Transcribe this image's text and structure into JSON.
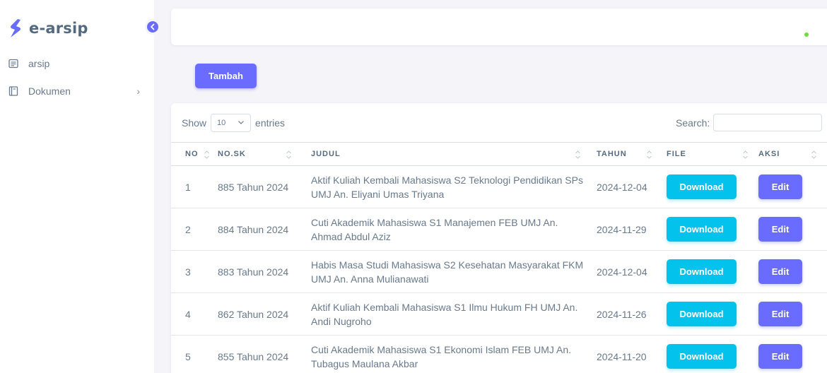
{
  "brand": {
    "name": "e-arsip",
    "logo_icon": "bolt-logo-icon",
    "accent": "#696cff"
  },
  "sidebar": {
    "collapse_icon": "chevron-left-icon",
    "items": [
      {
        "label": "arsip",
        "icon": "list-icon"
      },
      {
        "label": "Dokumen",
        "icon": "book-icon",
        "has_submenu": true
      }
    ]
  },
  "navbar": {
    "status_color": "#71dd37"
  },
  "actions": {
    "add_label": "Tambah"
  },
  "table": {
    "show_label": "Show",
    "entries_value": "10",
    "entries_label": "entries",
    "search_label": "Search:",
    "columns": [
      "NO",
      "NO.SK",
      "JUDUL",
      "TAHUN",
      "FILE",
      "AKSI"
    ],
    "rows": [
      {
        "no": "1",
        "sk": "885 Tahun 2024",
        "judul": "Aktif Kuliah Kembali Mahasiswa S2 Teknologi Pendidikan SPs UMJ An. Eliyani Umas Triyana",
        "tahun": "2024-12-04",
        "file_label": "Download",
        "action_label": "Edit"
      },
      {
        "no": "2",
        "sk": "884 Tahun 2024",
        "judul": "Cuti Akademik Mahasiswa S1 Manajemen FEB UMJ An. Ahmad Abdul Aziz",
        "tahun": "2024-11-29",
        "file_label": "Download",
        "action_label": "Edit"
      },
      {
        "no": "3",
        "sk": "883 Tahun 2024",
        "judul": "Habis Masa Studi Mahasiswa S2 Kesehatan Masyarakat FKM UMJ An. Anna Mulianawati",
        "tahun": "2024-12-04",
        "file_label": "Download",
        "action_label": "Edit"
      },
      {
        "no": "4",
        "sk": "862 Tahun 2024",
        "judul": "Aktif Kuliah Kembali Mahasiswa S1 Ilmu Hukum FH UMJ An. Andi Nugroho",
        "tahun": "2024-11-26",
        "file_label": "Download",
        "action_label": "Edit"
      },
      {
        "no": "5",
        "sk": "855 Tahun 2024",
        "judul": "Cuti Akademik Mahasiswa S1 Ekonomi Islam FEB UMJ An. Tubagus Maulana Akbar",
        "tahun": "2024-11-20",
        "file_label": "Download",
        "action_label": "Edit"
      }
    ]
  }
}
